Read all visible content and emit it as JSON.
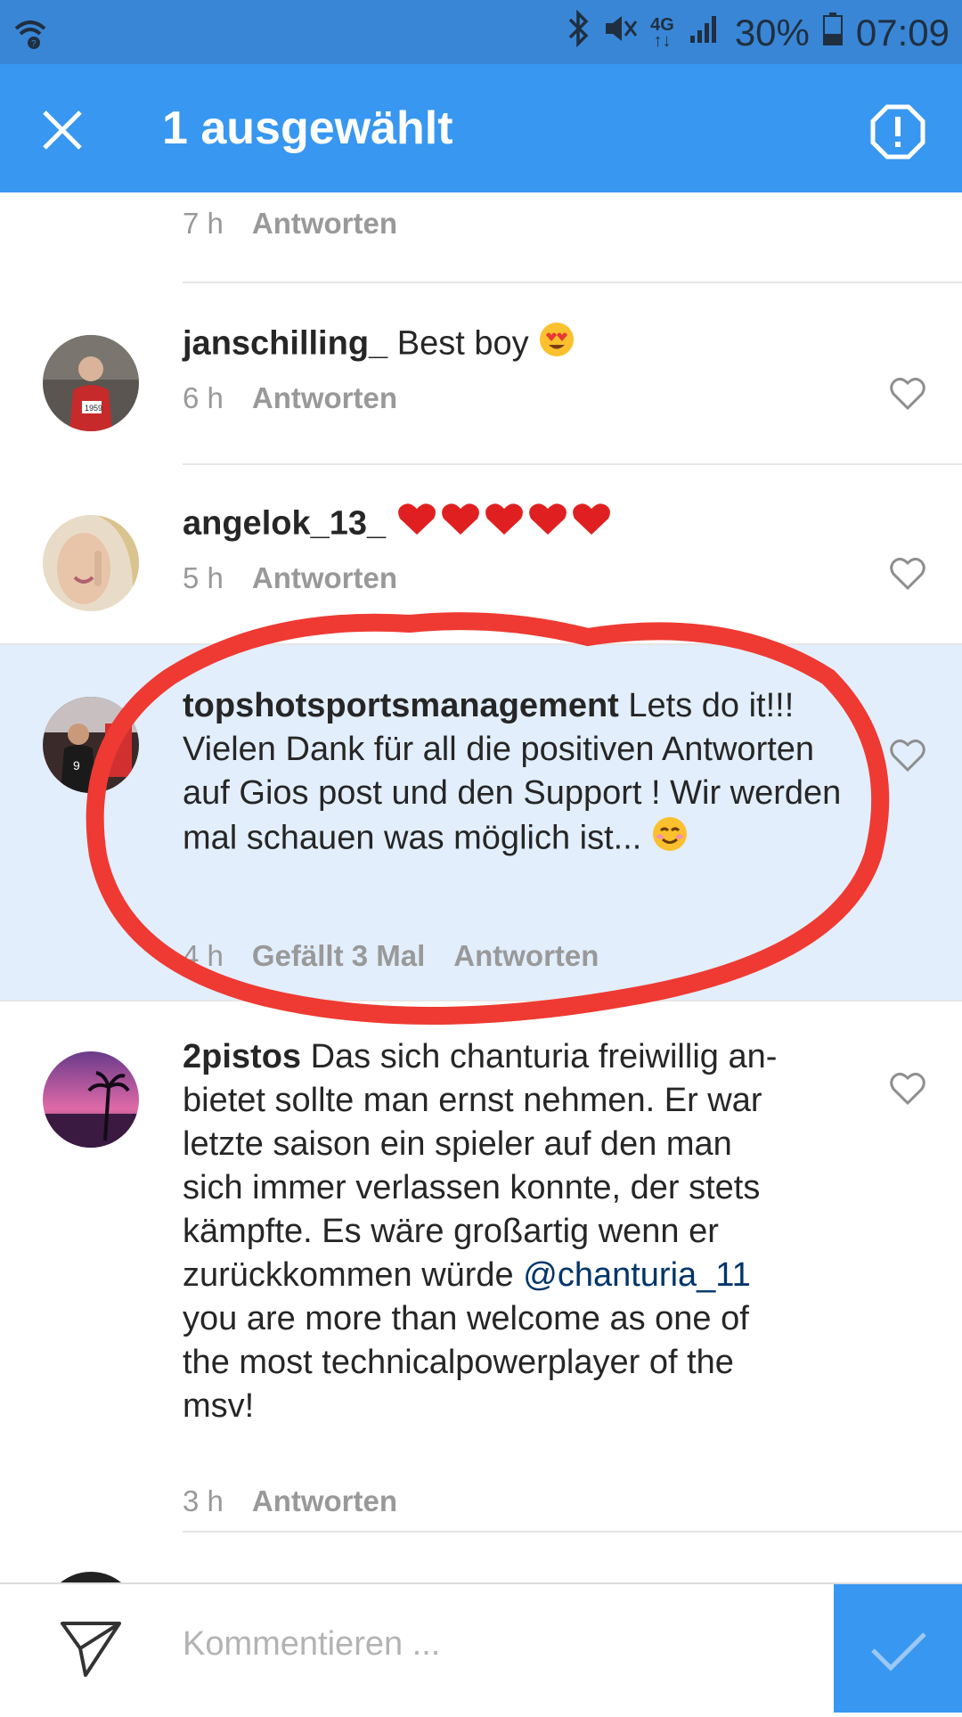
{
  "status_bar": {
    "battery": "30%",
    "time": "07:09",
    "network_top": "4G",
    "network_bottom": "↑↓"
  },
  "app_bar": {
    "title": "1 ausgewählt"
  },
  "top_partial": {
    "time": "7 h",
    "reply": "Antworten"
  },
  "comments": [
    {
      "username": "janschilling_",
      "text": "Best boy",
      "time": "6 h",
      "reply": "Antworten"
    },
    {
      "username": "angelok_13_",
      "text": "",
      "time": "5 h",
      "reply": "Antworten"
    },
    {
      "username": "topshotsportsmanagement",
      "text": "Lets do it!!! Vielen Dank für all die positiven Antworten auf Gios post und den Support ! Wir werden mal schauen was möglich ist...",
      "time": "4 h",
      "likes": "Gefällt 3 Mal",
      "reply": "Antworten"
    },
    {
      "username": "2pistos",
      "text_line1": "Das sich chanturia freiwillig an-",
      "text_line2": "bietet sollte man ernst nehmen. Er war",
      "text_line3": "letzte saison ein spieler auf den man",
      "text_line4": "sich immer verlassen konnte, der stets",
      "text_line5": "kämpfte. Es wäre großartig wenn er",
      "text_line6": "zurückkommen würde",
      "mention": "@chanturia_11",
      "text_line7": "you are more than welcome as one of",
      "text_line8": "the most technicalpowerplayer of the",
      "text_line9": "msv!",
      "time": "3 h",
      "reply": "Antworten"
    }
  ],
  "bottom_bar": {
    "placeholder": "Kommentieren ..."
  },
  "colors": {
    "accent": "#3897f0",
    "selected_row": "#e2eefc",
    "annotation": "#ee3a32"
  }
}
